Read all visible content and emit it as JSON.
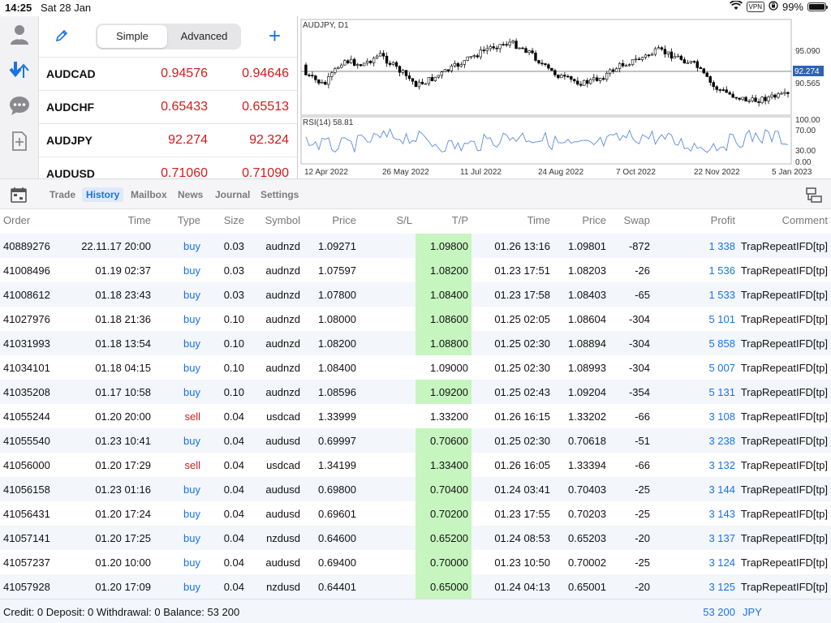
{
  "status_bar": {
    "time": "14:25",
    "date": "Sat 28 Jan",
    "vpn": "VPN",
    "battery": "99%",
    "battery_level": 0.99
  },
  "quotes": {
    "segment": {
      "simple": "Simple",
      "advanced": "Advanced"
    },
    "rows": [
      {
        "symbol": "AUDCAD",
        "bid": "0.94576",
        "ask": "0.94646"
      },
      {
        "symbol": "AUDCHF",
        "bid": "0.65433",
        "ask": "0.65513"
      },
      {
        "symbol": "AUDJPY",
        "bid": "92.274",
        "ask": "92.324"
      },
      {
        "symbol": "AUDUSD",
        "bid": "0.71060",
        "ask": "0.71090"
      }
    ]
  },
  "chart": {
    "title": "AUDJPY, D1",
    "price_ticks": [
      "95.090",
      "90.565"
    ],
    "current_price": "92.274",
    "rsi_label": "RSI(14) 58.81",
    "rsi_ticks": [
      "100.00",
      "70.00",
      "30.00",
      "0.00"
    ],
    "date_ticks": [
      "12 Apr 2022",
      "26 May 2022",
      "11 Jul 2022",
      "24 Aug 2022",
      "7 Oct 2022",
      "22 Nov 2022",
      "5 Jan 2023"
    ],
    "colors": {
      "bull": "#ffffff",
      "bear": "#000000",
      "rsi": "#5b8be0",
      "price_line": "#888888",
      "current_badge": "#2f62b3"
    }
  },
  "tabs": {
    "items": [
      {
        "label": "Trade",
        "active": false
      },
      {
        "label": "History",
        "active": true
      },
      {
        "label": "Mailbox",
        "active": false
      },
      {
        "label": "News",
        "active": false
      },
      {
        "label": "Journal",
        "active": false
      },
      {
        "label": "Settings",
        "active": false
      }
    ]
  },
  "history": {
    "headers": {
      "order": "Order",
      "time": "Time",
      "type": "Type",
      "size": "Size",
      "symbol": "Symbol",
      "price": "Price",
      "sl": "S/L",
      "tp": "T/P",
      "time2": "Time",
      "price2": "Price",
      "swap": "Swap",
      "profit": "Profit",
      "comment": "Comment"
    },
    "rows": [
      {
        "order": "40889276",
        "time": "22.11.17 20:00",
        "type": "buy",
        "size": "0.03",
        "symbol": "audnzd",
        "price": "1.09271",
        "sl": "",
        "tp": "1.09800",
        "tp_hit": true,
        "time2": "01.26 13:16",
        "price2": "1.09801",
        "swap": "-872",
        "profit": "1 338",
        "comment": "TrapRepeatIFD[tp]"
      },
      {
        "order": "41008496",
        "time": "01.19 02:37",
        "type": "buy",
        "size": "0.03",
        "symbol": "audnzd",
        "price": "1.07597",
        "sl": "",
        "tp": "1.08200",
        "tp_hit": true,
        "time2": "01.23 17:51",
        "price2": "1.08203",
        "swap": "-26",
        "profit": "1 536",
        "comment": "TrapRepeatIFD[tp]"
      },
      {
        "order": "41008612",
        "time": "01.18 23:43",
        "type": "buy",
        "size": "0.03",
        "symbol": "audnzd",
        "price": "1.07800",
        "sl": "",
        "tp": "1.08400",
        "tp_hit": true,
        "time2": "01.23 17:58",
        "price2": "1.08403",
        "swap": "-65",
        "profit": "1 533",
        "comment": "TrapRepeatIFD[tp]"
      },
      {
        "order": "41027976",
        "time": "01.18 21:36",
        "type": "buy",
        "size": "0.10",
        "symbol": "audnzd",
        "price": "1.08000",
        "sl": "",
        "tp": "1.08600",
        "tp_hit": true,
        "time2": "01.25 02:05",
        "price2": "1.08604",
        "swap": "-304",
        "profit": "5 101",
        "comment": "TrapRepeatIFD[tp]"
      },
      {
        "order": "41031993",
        "time": "01.18 13:54",
        "type": "buy",
        "size": "0.10",
        "symbol": "audnzd",
        "price": "1.08200",
        "sl": "",
        "tp": "1.08800",
        "tp_hit": true,
        "time2": "01.25 02:30",
        "price2": "1.08894",
        "swap": "-304",
        "profit": "5 858",
        "comment": "TrapRepeatIFD[tp]"
      },
      {
        "order": "41034101",
        "time": "01.18 04:15",
        "type": "buy",
        "size": "0.10",
        "symbol": "audnzd",
        "price": "1.08400",
        "sl": "",
        "tp": "1.09000",
        "tp_hit": false,
        "time2": "01.25 02:30",
        "price2": "1.08993",
        "swap": "-304",
        "profit": "5 007",
        "comment": "TrapRepeatIFD[tp]"
      },
      {
        "order": "41035208",
        "time": "01.17 10:58",
        "type": "buy",
        "size": "0.10",
        "symbol": "audnzd",
        "price": "1.08596",
        "sl": "",
        "tp": "1.09200",
        "tp_hit": true,
        "time2": "01.25 02:43",
        "price2": "1.09204",
        "swap": "-354",
        "profit": "5 131",
        "comment": "TrapRepeatIFD[tp]"
      },
      {
        "order": "41055244",
        "time": "01.20 20:00",
        "type": "sell",
        "size": "0.04",
        "symbol": "usdcad",
        "price": "1.33999",
        "sl": "",
        "tp": "1.33200",
        "tp_hit": false,
        "time2": "01.26 16:15",
        "price2": "1.33202",
        "swap": "-66",
        "profit": "3 108",
        "comment": "TrapRepeatIFD[tp]"
      },
      {
        "order": "41055540",
        "time": "01.23 10:41",
        "type": "buy",
        "size": "0.04",
        "symbol": "audusd",
        "price": "0.69997",
        "sl": "",
        "tp": "0.70600",
        "tp_hit": true,
        "time2": "01.25 02:30",
        "price2": "0.70618",
        "swap": "-51",
        "profit": "3 238",
        "comment": "TrapRepeatIFD[tp]"
      },
      {
        "order": "41056000",
        "time": "01.20 17:29",
        "type": "sell",
        "size": "0.04",
        "symbol": "usdcad",
        "price": "1.34199",
        "sl": "",
        "tp": "1.33400",
        "tp_hit": true,
        "time2": "01.26 16:05",
        "price2": "1.33394",
        "swap": "-66",
        "profit": "3 132",
        "comment": "TrapRepeatIFD[tp]"
      },
      {
        "order": "41056158",
        "time": "01.23 01:16",
        "type": "buy",
        "size": "0.04",
        "symbol": "audusd",
        "price": "0.69800",
        "sl": "",
        "tp": "0.70400",
        "tp_hit": true,
        "time2": "01.24 03:41",
        "price2": "0.70403",
        "swap": "-25",
        "profit": "3 144",
        "comment": "TrapRepeatIFD[tp]"
      },
      {
        "order": "41056431",
        "time": "01.20 17:24",
        "type": "buy",
        "size": "0.04",
        "symbol": "audusd",
        "price": "0.69601",
        "sl": "",
        "tp": "0.70200",
        "tp_hit": true,
        "time2": "01.23 17:55",
        "price2": "0.70203",
        "swap": "-25",
        "profit": "3 143",
        "comment": "TrapRepeatIFD[tp]"
      },
      {
        "order": "41057141",
        "time": "01.20 17:25",
        "type": "buy",
        "size": "0.04",
        "symbol": "nzdusd",
        "price": "0.64600",
        "sl": "",
        "tp": "0.65200",
        "tp_hit": true,
        "time2": "01.24 08:53",
        "price2": "0.65203",
        "swap": "-20",
        "profit": "3 137",
        "comment": "TrapRepeatIFD[tp]"
      },
      {
        "order": "41057237",
        "time": "01.20 10:00",
        "type": "buy",
        "size": "0.04",
        "symbol": "audusd",
        "price": "0.69400",
        "sl": "",
        "tp": "0.70000",
        "tp_hit": true,
        "time2": "01.23 10:50",
        "price2": "0.70002",
        "swap": "-25",
        "profit": "3 124",
        "comment": "TrapRepeatIFD[tp]"
      },
      {
        "order": "41057928",
        "time": "01.20 17:09",
        "type": "buy",
        "size": "0.04",
        "symbol": "nzdusd",
        "price": "0.64401",
        "sl": "",
        "tp": "0.65000",
        "tp_hit": true,
        "time2": "01.24 04:13",
        "price2": "0.65001",
        "swap": "-20",
        "profit": "3 125",
        "comment": "TrapRepeatIFD[tp]"
      }
    ]
  },
  "footer": {
    "summary": "Credit: 0 Deposit: 0 Withdrawal: 0 Balance: 53 200",
    "total": "53 200",
    "currency": "JPY"
  },
  "icons": {
    "rail": [
      "account-icon",
      "trade-arrows-icon",
      "chat-icon",
      "new-document-icon"
    ],
    "edit": "pencil-icon",
    "add": "plus-icon",
    "calendar": "calendar-icon",
    "layout": "layout-icon"
  }
}
